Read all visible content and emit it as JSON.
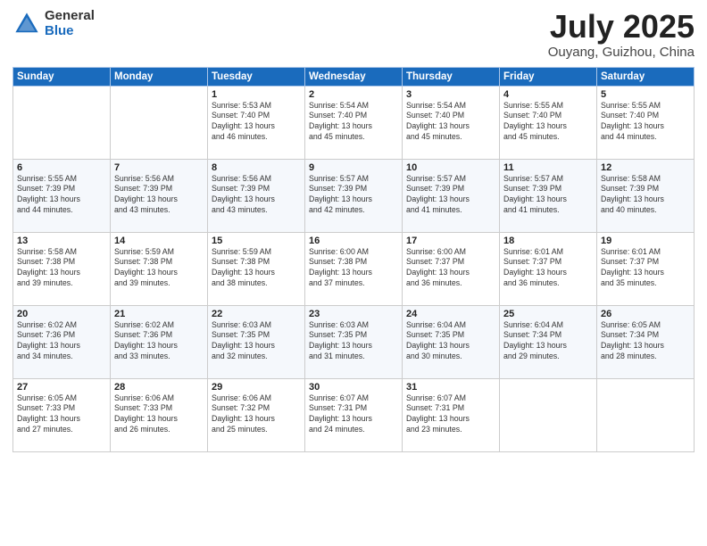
{
  "logo": {
    "general": "General",
    "blue": "Blue"
  },
  "title": "July 2025",
  "subtitle": "Ouyang, Guizhou, China",
  "weekdays": [
    "Sunday",
    "Monday",
    "Tuesday",
    "Wednesday",
    "Thursday",
    "Friday",
    "Saturday"
  ],
  "weeks": [
    [
      {
        "day": "",
        "detail": ""
      },
      {
        "day": "",
        "detail": ""
      },
      {
        "day": "1",
        "detail": "Sunrise: 5:53 AM\nSunset: 7:40 PM\nDaylight: 13 hours\nand 46 minutes."
      },
      {
        "day": "2",
        "detail": "Sunrise: 5:54 AM\nSunset: 7:40 PM\nDaylight: 13 hours\nand 45 minutes."
      },
      {
        "day": "3",
        "detail": "Sunrise: 5:54 AM\nSunset: 7:40 PM\nDaylight: 13 hours\nand 45 minutes."
      },
      {
        "day": "4",
        "detail": "Sunrise: 5:55 AM\nSunset: 7:40 PM\nDaylight: 13 hours\nand 45 minutes."
      },
      {
        "day": "5",
        "detail": "Sunrise: 5:55 AM\nSunset: 7:40 PM\nDaylight: 13 hours\nand 44 minutes."
      }
    ],
    [
      {
        "day": "6",
        "detail": "Sunrise: 5:55 AM\nSunset: 7:39 PM\nDaylight: 13 hours\nand 44 minutes."
      },
      {
        "day": "7",
        "detail": "Sunrise: 5:56 AM\nSunset: 7:39 PM\nDaylight: 13 hours\nand 43 minutes."
      },
      {
        "day": "8",
        "detail": "Sunrise: 5:56 AM\nSunset: 7:39 PM\nDaylight: 13 hours\nand 43 minutes."
      },
      {
        "day": "9",
        "detail": "Sunrise: 5:57 AM\nSunset: 7:39 PM\nDaylight: 13 hours\nand 42 minutes."
      },
      {
        "day": "10",
        "detail": "Sunrise: 5:57 AM\nSunset: 7:39 PM\nDaylight: 13 hours\nand 41 minutes."
      },
      {
        "day": "11",
        "detail": "Sunrise: 5:57 AM\nSunset: 7:39 PM\nDaylight: 13 hours\nand 41 minutes."
      },
      {
        "day": "12",
        "detail": "Sunrise: 5:58 AM\nSunset: 7:39 PM\nDaylight: 13 hours\nand 40 minutes."
      }
    ],
    [
      {
        "day": "13",
        "detail": "Sunrise: 5:58 AM\nSunset: 7:38 PM\nDaylight: 13 hours\nand 39 minutes."
      },
      {
        "day": "14",
        "detail": "Sunrise: 5:59 AM\nSunset: 7:38 PM\nDaylight: 13 hours\nand 39 minutes."
      },
      {
        "day": "15",
        "detail": "Sunrise: 5:59 AM\nSunset: 7:38 PM\nDaylight: 13 hours\nand 38 minutes."
      },
      {
        "day": "16",
        "detail": "Sunrise: 6:00 AM\nSunset: 7:38 PM\nDaylight: 13 hours\nand 37 minutes."
      },
      {
        "day": "17",
        "detail": "Sunrise: 6:00 AM\nSunset: 7:37 PM\nDaylight: 13 hours\nand 36 minutes."
      },
      {
        "day": "18",
        "detail": "Sunrise: 6:01 AM\nSunset: 7:37 PM\nDaylight: 13 hours\nand 36 minutes."
      },
      {
        "day": "19",
        "detail": "Sunrise: 6:01 AM\nSunset: 7:37 PM\nDaylight: 13 hours\nand 35 minutes."
      }
    ],
    [
      {
        "day": "20",
        "detail": "Sunrise: 6:02 AM\nSunset: 7:36 PM\nDaylight: 13 hours\nand 34 minutes."
      },
      {
        "day": "21",
        "detail": "Sunrise: 6:02 AM\nSunset: 7:36 PM\nDaylight: 13 hours\nand 33 minutes."
      },
      {
        "day": "22",
        "detail": "Sunrise: 6:03 AM\nSunset: 7:35 PM\nDaylight: 13 hours\nand 32 minutes."
      },
      {
        "day": "23",
        "detail": "Sunrise: 6:03 AM\nSunset: 7:35 PM\nDaylight: 13 hours\nand 31 minutes."
      },
      {
        "day": "24",
        "detail": "Sunrise: 6:04 AM\nSunset: 7:35 PM\nDaylight: 13 hours\nand 30 minutes."
      },
      {
        "day": "25",
        "detail": "Sunrise: 6:04 AM\nSunset: 7:34 PM\nDaylight: 13 hours\nand 29 minutes."
      },
      {
        "day": "26",
        "detail": "Sunrise: 6:05 AM\nSunset: 7:34 PM\nDaylight: 13 hours\nand 28 minutes."
      }
    ],
    [
      {
        "day": "27",
        "detail": "Sunrise: 6:05 AM\nSunset: 7:33 PM\nDaylight: 13 hours\nand 27 minutes."
      },
      {
        "day": "28",
        "detail": "Sunrise: 6:06 AM\nSunset: 7:33 PM\nDaylight: 13 hours\nand 26 minutes."
      },
      {
        "day": "29",
        "detail": "Sunrise: 6:06 AM\nSunset: 7:32 PM\nDaylight: 13 hours\nand 25 minutes."
      },
      {
        "day": "30",
        "detail": "Sunrise: 6:07 AM\nSunset: 7:31 PM\nDaylight: 13 hours\nand 24 minutes."
      },
      {
        "day": "31",
        "detail": "Sunrise: 6:07 AM\nSunset: 7:31 PM\nDaylight: 13 hours\nand 23 minutes."
      },
      {
        "day": "",
        "detail": ""
      },
      {
        "day": "",
        "detail": ""
      }
    ]
  ]
}
